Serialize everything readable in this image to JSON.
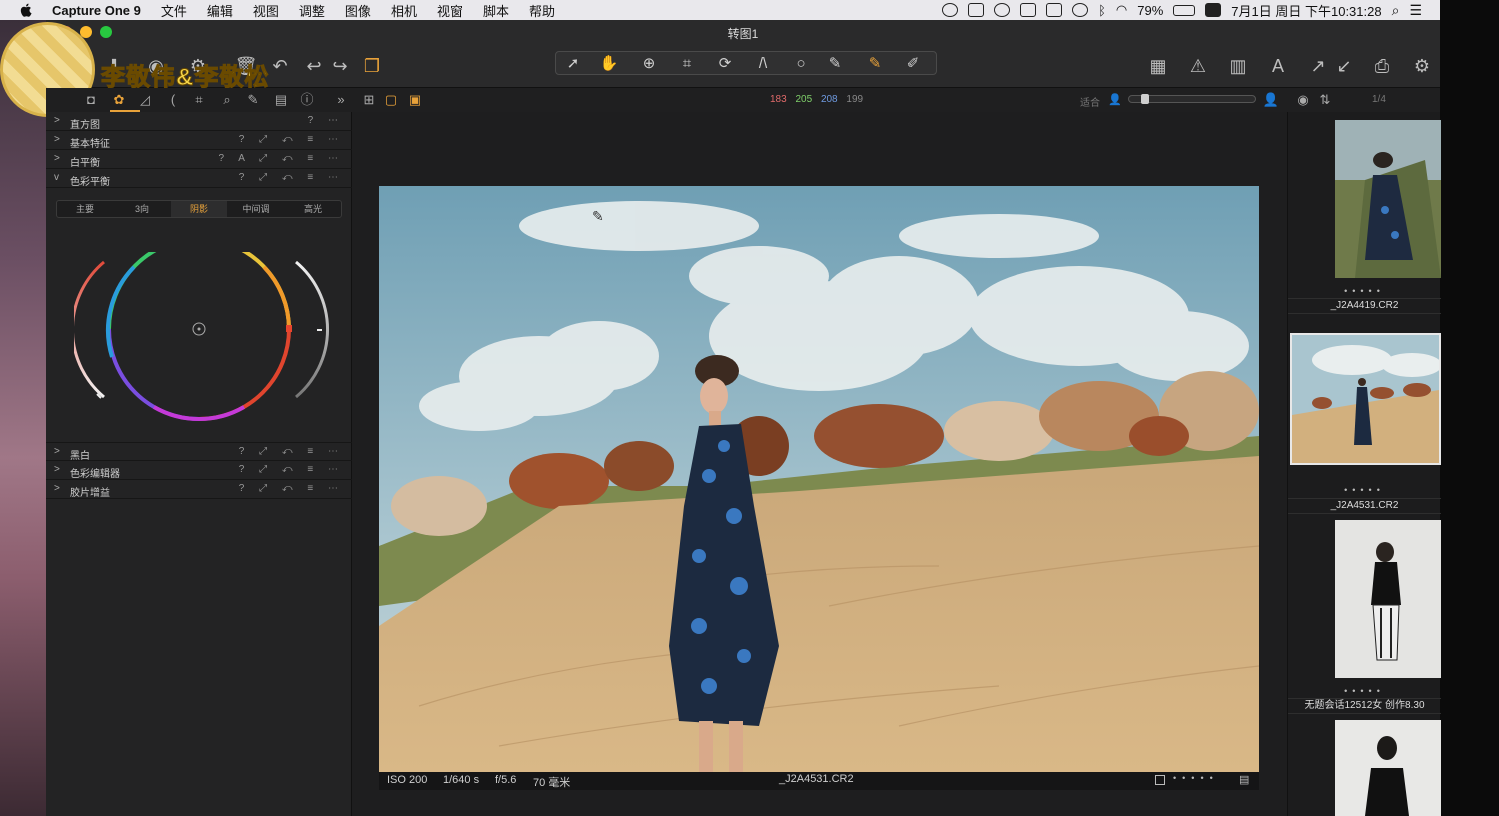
{
  "menubar": {
    "app_name": "Capture One 9",
    "menus": [
      "文件",
      "编辑",
      "视图",
      "调整",
      "图像",
      "相机",
      "视窗",
      "脚本",
      "帮助"
    ],
    "battery": "79%",
    "clock": "7月1日 周日 下午10:31:28"
  },
  "window": {
    "title": "转图1"
  },
  "watermark": {
    "text": "李敬伟&李敬松"
  },
  "viewbar": {
    "rgb_r": "183",
    "rgb_g": "205",
    "rgb_b": "208",
    "rgb_l": "199",
    "fit_label": "适合",
    "page_counter": "1/4"
  },
  "left_panel": {
    "sections": [
      {
        "label": "直方图",
        "expanded": false
      },
      {
        "label": "基本特征",
        "expanded": false
      },
      {
        "label": "白平衡",
        "expanded": false
      },
      {
        "label": "色彩平衡",
        "expanded": true
      }
    ],
    "color_balance_tabs": [
      "主要",
      "3向",
      "阴影",
      "中间调",
      "高光"
    ],
    "active_tab": "阴影",
    "lower_sections": [
      {
        "label": "黑白"
      },
      {
        "label": "色彩编辑器"
      },
      {
        "label": "胶片增益"
      }
    ]
  },
  "viewer": {
    "iso": "ISO 200",
    "shutter": "1/640 s",
    "aperture": "f/5.6",
    "focal": "70 毫米",
    "filename": "_J2A4531.CR2"
  },
  "browser": {
    "items": [
      {
        "caption": "_J2A4419.CR2"
      },
      {
        "caption": "_J2A4531.CR2",
        "selected": true
      },
      {
        "caption": "无题会话12512女 创作8.30"
      }
    ]
  },
  "colors": {
    "accent": "#e8a23a",
    "panel_bg": "#232324",
    "viewer_bg": "#1e1e1f"
  }
}
